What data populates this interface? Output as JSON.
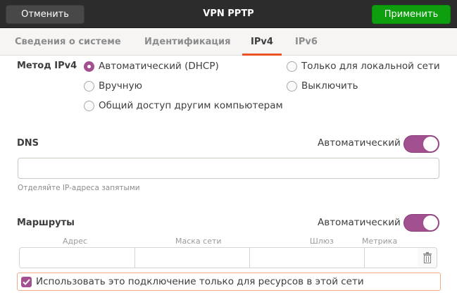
{
  "header": {
    "title": "VPN PPTP",
    "cancel": "Отменить",
    "apply": "Применить"
  },
  "tabs": [
    "Сведения о системе",
    "Идентификация",
    "IPv4",
    "IPv6"
  ],
  "active_tab": "IPv4",
  "method": {
    "label": "Метод IPv4",
    "options": [
      "Автоматический (DHCP)",
      "Вручную",
      "Общий доступ другим компьютерам",
      "Только для локальной сети",
      "Выключить"
    ],
    "selected": "Автоматический (DHCP)"
  },
  "dns": {
    "label": "DNS",
    "auto_label": "Автоматический",
    "auto_on": true,
    "value": "",
    "hint": "Отделяйте IP-адреса запятыми"
  },
  "routes": {
    "label": "Маршруты",
    "auto_label": "Автоматический",
    "auto_on": true,
    "columns": [
      "Адрес",
      "Маска сети",
      "Шлюз",
      "Метрика"
    ]
  },
  "only_local": {
    "label": "Использовать это подключение только для ресурсов в этой сети",
    "checked": true
  },
  "colors": {
    "accent": "#a2508f",
    "tab_underline": "#e95420",
    "apply": "#0e9f0e"
  }
}
